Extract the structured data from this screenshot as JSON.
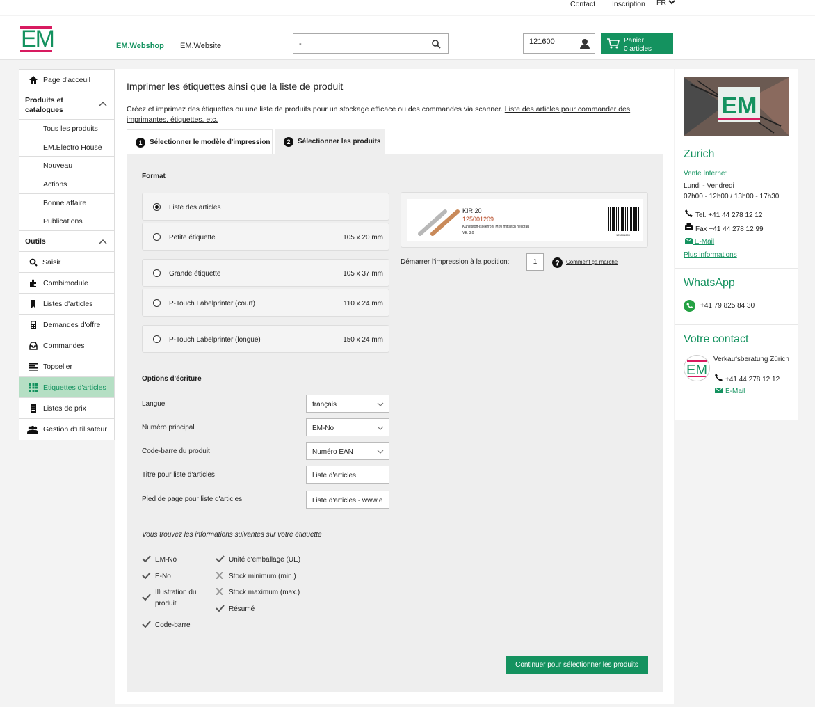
{
  "topbar": {
    "contact": "Contact",
    "inscription": "Inscription",
    "lang": "FR"
  },
  "header": {
    "logo": "EM",
    "nav": [
      "EM.Webshop",
      "EM.Website"
    ],
    "search_value": "-",
    "account_number": "121600",
    "cart_label": "Panier",
    "cart_count": "0 articles"
  },
  "sidebar": {
    "home": "Page d'acceuil",
    "group1": "Produits et catalogues",
    "group1_items": [
      "Tous les produits",
      "EM.Electro House",
      "Nouveau",
      "Actions",
      "Bonne affaire",
      "Publications"
    ],
    "group2": "Outils",
    "tools": [
      "Saisir",
      "Combimodule",
      "Listes d'articles",
      "Demandes d'offre",
      "Commandes",
      "Topseller",
      "Etiquettes d'articles",
      "Listes de prix",
      "Gestion d'utilisateur"
    ]
  },
  "main": {
    "title": "Imprimer les étiquettes ainsi que la liste de produit",
    "intro_text": "Créez et imprimez des étiquettes ou une liste de produits pour un stockage efficace ou des commandes via scanner. ",
    "intro_link": "Liste des articles pour commander des imprimantes, étiquettes, etc.",
    "tabs": [
      {
        "num": "1",
        "label": "Sélectionner le modèle d'impression"
      },
      {
        "num": "2",
        "label": "Sélectionner les produits"
      }
    ],
    "format_title": "Format",
    "formats": [
      {
        "name": "Liste des articles",
        "size": "",
        "selected": true
      },
      {
        "name": "Petite étiquette",
        "size": "105 x 20 mm",
        "selected": false
      },
      {
        "name": "Grande étiquette",
        "size": "105 x 37 mm",
        "selected": false
      },
      {
        "name": "P-Touch Labelprinter (court)",
        "size": "110 x 24 mm",
        "selected": false
      },
      {
        "name": "P-Touch Labelprinter (longue)",
        "size": "150 x 24 mm",
        "selected": false
      }
    ],
    "preview": {
      "line1": "KIR 20",
      "line2": "125001209",
      "line3": "Kunststoff-Isolierrohr M20 mittlstch hellgrau",
      "line4": "VE: 3.0",
      "barcode_no": "125001209"
    },
    "start_pos_label": "Démarrer l'impression à la position:",
    "start_pos_value": "1",
    "howto": "Comment ça marche",
    "options_title": "Options d'écriture",
    "options": [
      {
        "label": "Langue",
        "value": "français",
        "type": "select"
      },
      {
        "label": "Numéro principal",
        "value": "EM-No",
        "type": "select"
      },
      {
        "label": "Code-barre du produit",
        "value": "Numéro EAN",
        "type": "select"
      },
      {
        "label": "Titre pour liste d'articles",
        "value": "Liste d'articles",
        "type": "text"
      },
      {
        "label": "Pied de page pour liste d'articles",
        "value": "Liste d'articles - www.e",
        "type": "text"
      }
    ],
    "info_title": "Vous trouvez les informations suivantes sur votre étiquette",
    "info_left": [
      {
        "label": "EM-No",
        "ok": true
      },
      {
        "label": "E-No",
        "ok": true
      },
      {
        "label": "Illustration du produit",
        "ok": true
      },
      {
        "label": "Code-barre",
        "ok": true
      }
    ],
    "info_right": [
      {
        "label": "Unité d'emballage (UE)",
        "ok": true
      },
      {
        "label": "Stock minimum (min.)",
        "ok": false
      },
      {
        "label": "Stock maximum (max.)",
        "ok": false
      },
      {
        "label": "Résumé",
        "ok": true
      }
    ],
    "continue_button": "Continuer pour sélectionner les produits"
  },
  "right": {
    "city": "Zurich",
    "sales_label": "Vente Interne:",
    "days": "Lundi - Vendredi",
    "hours": "07h00 - 12h00 / 13h00 - 17h30",
    "tel": "Tel. +41 44 278 12 12",
    "fax": "Fax +41 44 278 12 99",
    "email": " E-Mail",
    "more": "Plus informations",
    "whatsapp_title": "WhatsApp",
    "whatsapp_number": "+41 79 825 84 30",
    "contact_title": "Votre contact",
    "contact_name": "Verkaufsberatung Zürich",
    "contact_tel": "+41 44 278 12 12",
    "contact_email": "E-Mail"
  },
  "colors": {
    "brand_green": "#14925f",
    "brand_pink": "#d81b60",
    "active_bg": "#b5dfc4"
  }
}
